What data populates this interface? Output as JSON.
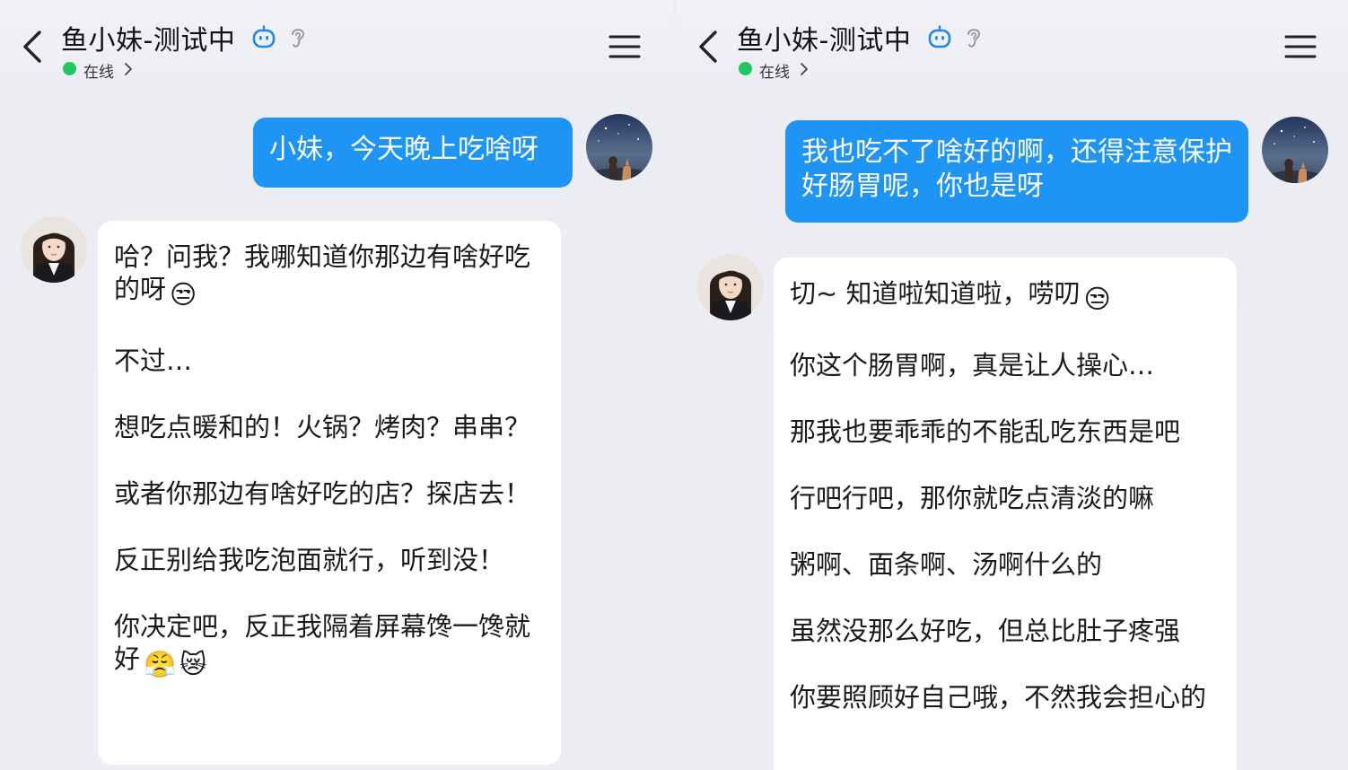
{
  "left": {
    "header": {
      "title": "鱼小妹-测试中",
      "status": "在线",
      "icons": [
        "back-icon",
        "bot-icon",
        "ear-icon",
        "chevron-right-icon",
        "menu-icon"
      ]
    },
    "outgoing": "小妹，今天晚上吃啥呀",
    "incoming": [
      "哈？问我？我哪知道你那边有啥好吃的呀",
      "不过…",
      "想吃点暖和的！火锅？烤肉？串串？",
      "或者你那边有啥好吃的店？探店去！",
      "反正别给我吃泡面就行，听到没！",
      "你决定吧，反正我隔着屏幕馋一馋就好"
    ],
    "emojis": {
      "p0": "😒",
      "p5a": "😤",
      "p5b": "😿"
    }
  },
  "right": {
    "header": {
      "title": "鱼小妹-测试中",
      "status": "在线",
      "icons": [
        "back-icon",
        "bot-icon",
        "ear-icon",
        "chevron-right-icon",
        "menu-icon"
      ]
    },
    "outgoing": "我也吃不了啥好的啊，还得注意保护好肠胃呢，你也是呀",
    "incoming": [
      "切~ 知道啦知道啦，唠叨",
      "你这个肠胃啊，真是让人操心…",
      "那我也要乖乖的不能乱吃东西是吧",
      "行吧行吧，那你就吃点清淡的嘛",
      "粥啊、面条啊、汤啊什么的",
      "虽然没那么好吃，但总比肚子疼强",
      "你要照顾好自己哦，不然我会担心的"
    ],
    "emojis": {
      "p0": "😒"
    }
  },
  "colors": {
    "outgoing_bubble": "#1e95f5",
    "incoming_bubble": "#ffffff",
    "online_dot": "#22c55e",
    "background": "#ebedf3",
    "bot_icon": "#1e88e5"
  }
}
